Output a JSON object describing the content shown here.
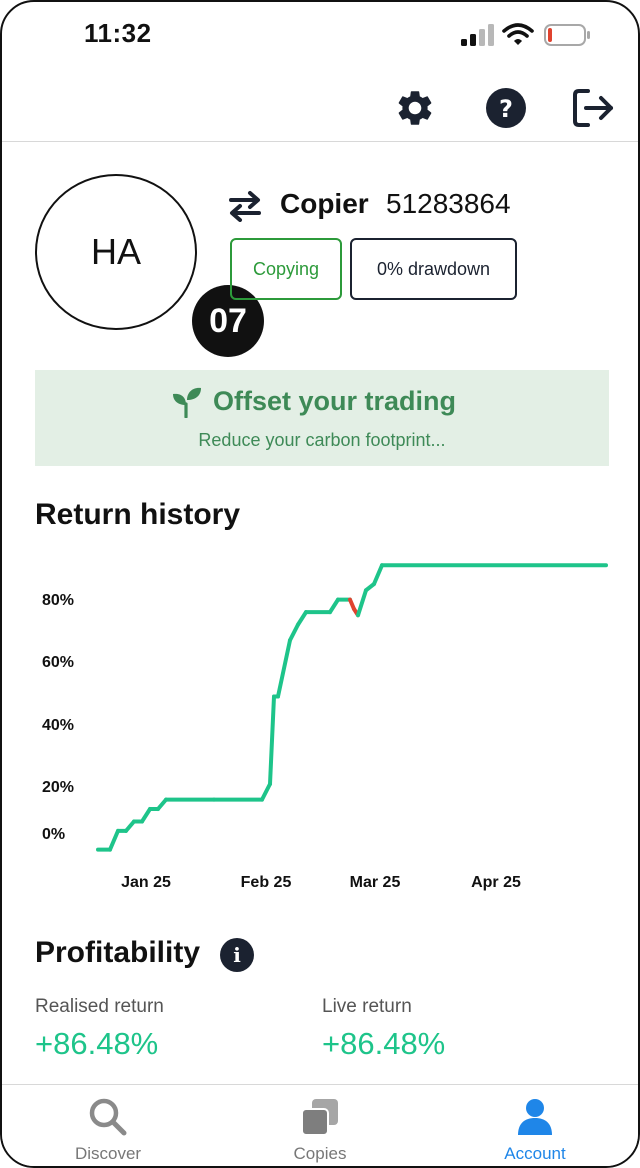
{
  "status_bar": {
    "time": "11:32",
    "icons": [
      "cellular-signal-icon",
      "wifi-icon",
      "battery-low-icon"
    ],
    "battery_color": "#e0432f"
  },
  "toolbar": {
    "icons": [
      "gear-icon",
      "help-icon",
      "logout-icon"
    ]
  },
  "profile": {
    "initials": "HA",
    "level": "07",
    "swap_icon": "swap-arrows-icon",
    "role": "Copier",
    "account_id": "51283864",
    "status_pill": "Copying",
    "drawdown_pill": "0% drawdown"
  },
  "offset_banner": {
    "icon": "sprout-icon",
    "title": "Offset your trading",
    "subtitle": "Reduce your carbon footprint..."
  },
  "return_history": {
    "title": "Return history"
  },
  "chart_data": {
    "type": "line",
    "title": "Return history",
    "xlabel": "",
    "ylabel": "",
    "y_tick_labels": [
      "80%",
      "60%",
      "40%",
      "20%",
      "0%"
    ],
    "x_tick_labels": [
      "Jan 25",
      "Feb 25",
      "Mar 25",
      "Apr 25"
    ],
    "grid": false,
    "series": [
      {
        "color": "#1ec48a",
        "negative_color": "#e0432f",
        "points": [
          {
            "x": "2024-12-31",
            "y": -5
          },
          {
            "x": "2025-01-03",
            "y": -5
          },
          {
            "x": "2025-01-05",
            "y": 1
          },
          {
            "x": "2025-01-07",
            "y": 1
          },
          {
            "x": "2025-01-09",
            "y": 4
          },
          {
            "x": "2025-01-11",
            "y": 4
          },
          {
            "x": "2025-01-13",
            "y": 8
          },
          {
            "x": "2025-01-15",
            "y": 8
          },
          {
            "x": "2025-01-17",
            "y": 11
          },
          {
            "x": "2025-01-29",
            "y": 11
          },
          {
            "x": "2025-02-10",
            "y": 11
          },
          {
            "x": "2025-02-12",
            "y": 16
          },
          {
            "x": "2025-02-13",
            "y": 44
          },
          {
            "x": "2025-02-14",
            "y": 44
          },
          {
            "x": "2025-02-17",
            "y": 62
          },
          {
            "x": "2025-02-19",
            "y": 67
          },
          {
            "x": "2025-02-21",
            "y": 71
          },
          {
            "x": "2025-02-27",
            "y": 71
          },
          {
            "x": "2025-03-01",
            "y": 75
          },
          {
            "x": "2025-03-04",
            "y": 75
          },
          {
            "x": "2025-03-05",
            "y": 72
          },
          {
            "x": "2025-03-06",
            "y": 70
          },
          {
            "x": "2025-03-08",
            "y": 78
          },
          {
            "x": "2025-03-10",
            "y": 80
          },
          {
            "x": "2025-03-12",
            "y": 86
          },
          {
            "x": "2025-05-07",
            "y": 86
          }
        ]
      }
    ]
  },
  "profitability": {
    "title": "Profitability",
    "info_icon": "info-icon",
    "realised_label": "Realised return",
    "realised_value": "+86.48%",
    "live_label": "Live return",
    "live_value": "+86.48%"
  },
  "bottom_nav": {
    "items": [
      {
        "label": "Discover",
        "icon": "search-icon"
      },
      {
        "label": "Copies",
        "icon": "copies-icon"
      },
      {
        "label": "Account",
        "icon": "person-icon"
      }
    ],
    "active_color": "#1f86e8"
  }
}
